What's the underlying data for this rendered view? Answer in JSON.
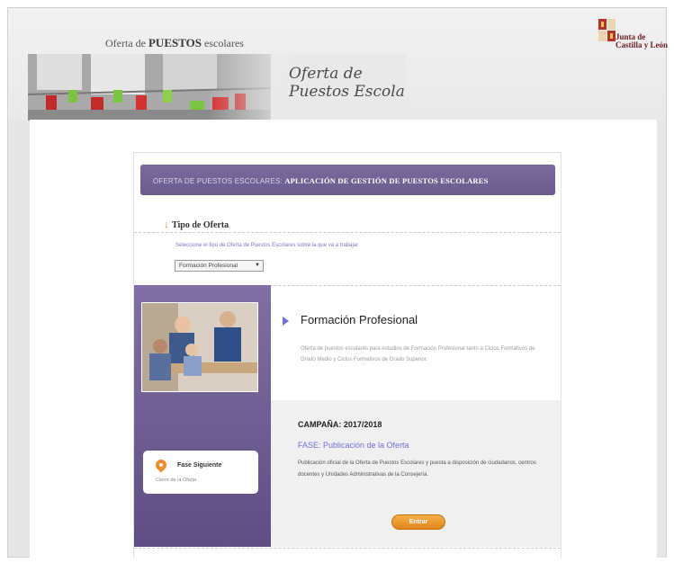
{
  "header": {
    "site_title_prefix": "Oferta de ",
    "site_title_bold": "PUESTOS",
    "site_title_suffix": " escolares",
    "banner_title": "Oferta de\nPuestos Escolares",
    "logo_text": "Junta de\nCastilla y León"
  },
  "card": {
    "header_prefix": "OFERTA DE PUESTOS ESCOLARES:",
    "header_app": "APLICACIÓN DE GESTIÓN DE PUESTOS ESCOLARES",
    "tipo_label": "Tipo de Oferta",
    "hint": "Seleccione el tipo de Oferta de Puestos Escolares sobre la que va a trabajar",
    "select_value": "Formación Profesional"
  },
  "offer": {
    "title": "Formación Profesional",
    "description": "Oferta de puestos escolares para estudios de Formación Profesional tanto a Ciclos Formativos de Grado Medio y Ciclos Formativos de Grado Superior.",
    "campaign": "CAMPAÑA: 2017/2018",
    "phase": "FASE: Publicación de la Oferta",
    "phase_description": "Publicación oficial de la Oferta de Puestos Escolares y puesta a disposición de ciudadanos, centros docentes y Unidades Administrativas de la Consejería.",
    "enter_label": "Entrar"
  },
  "next_phase": {
    "title": "Fase Siguiente",
    "subtitle": "Cierre de la Oferta"
  },
  "colors": {
    "header_purple": "#6f5f93",
    "link_blue": "#6f6fd8",
    "orange": "#e8881e"
  }
}
